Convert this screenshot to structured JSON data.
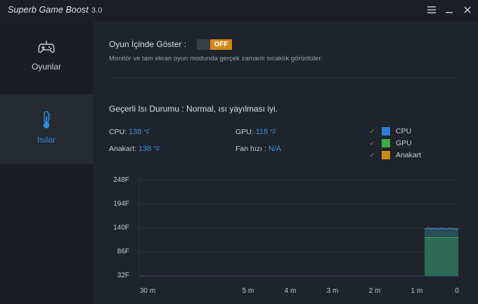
{
  "app": {
    "title": "Superb Game Boost",
    "version": "3.0"
  },
  "window_controls": [
    {
      "name": "menu-icon"
    },
    {
      "name": "minimize-icon"
    },
    {
      "name": "close-icon"
    }
  ],
  "sidebar": {
    "items": [
      {
        "label": "Oyunlar",
        "icon": "gamepad-icon",
        "active": false
      },
      {
        "label": "Isılar",
        "icon": "thermometer-icon",
        "active": true
      }
    ]
  },
  "overlay": {
    "label": "Oyun İçinde Göster :",
    "toggle_label": "OFF",
    "toggle_state": "off",
    "description": "Monitör ve tam ekran oyun modunda gerçek zamanlı sıcaklık görüntüler."
  },
  "status": {
    "text": "Geçerli Isı Durumu : Normal, ısı yayılması iyi."
  },
  "readings": {
    "cpu": {
      "label": "CPU:",
      "value": "138",
      "unit": "°F"
    },
    "gpu": {
      "label": "GPU:",
      "value": "118",
      "unit": "°F"
    },
    "board": {
      "label": "Anakart:",
      "value": "138",
      "unit": "°F"
    },
    "fan": {
      "label": "Fan hızı :",
      "value": "N/A"
    }
  },
  "legend": [
    {
      "label": "CPU",
      "color": "#2a7fd4",
      "checked": true
    },
    {
      "label": "GPU",
      "color": "#3daa47",
      "checked": true
    },
    {
      "label": "Anakart",
      "color": "#cc8a1c",
      "checked": true
    }
  ],
  "chart_data": {
    "type": "area",
    "y_ticks": [
      "248F",
      "194F",
      "140F",
      "86F",
      "32F"
    ],
    "ylim": [
      32,
      248
    ],
    "x_ticks": [
      "30 m",
      "5 m",
      "4 m",
      "3 m",
      "2 m",
      "1 m",
      "0"
    ],
    "series": [
      {
        "name": "CPU",
        "color": "#3b82c4",
        "values": [
          138
        ]
      },
      {
        "name": "GPU",
        "color": "#3daa47",
        "values": [
          118
        ]
      },
      {
        "name": "Anakart",
        "color": "#cc8a1c",
        "values": [
          138
        ]
      }
    ],
    "grid": true
  }
}
